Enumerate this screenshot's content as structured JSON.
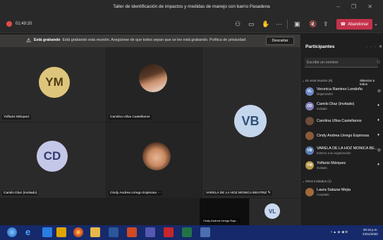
{
  "window": {
    "title": "Taller de identificación de impactos y medidas de manejo con barrio Pasadena"
  },
  "toolbar": {
    "timer": "01:49:20",
    "leave_label": "Abandonar",
    "icons": [
      "people-icon",
      "chat-icon",
      "raise-hand-icon",
      "more-icon",
      "camera-icon",
      "mic-icon",
      "share-icon"
    ]
  },
  "banner": {
    "bold": "Está grabando",
    "text": "Está grabando esta reunión. Asegúrese de que todos sepan que se les está grabando. Política de privacidad",
    "dismiss_label": "Descartar"
  },
  "tiles": [
    {
      "name": "Yolfanis Márquez",
      "initials": "YM",
      "color": "#ddc67c",
      "text_color": "#4f3a13"
    },
    {
      "name": "Carolina Ulloa Castellanos",
      "initials": "",
      "photo": true
    },
    {
      "name": "Camilo Díaz (Invitado)",
      "initials": "CD",
      "color": "#c4c8e8",
      "text_color": "#343a6a"
    },
    {
      "name": "Cindy Andrea Urrego Espinosa",
      "initials": "",
      "photo": true,
      "suffix": "···"
    },
    {
      "name": "VARELA DE LA HOZ MONICA BEATRIZ",
      "initials": "VB",
      "color": "#c4d6ec",
      "text_color": "#2f4f78"
    },
    {
      "name": "Cindy Andrea Urrego Espi...",
      "initials": "",
      "self_preview": true
    },
    {
      "name": "",
      "initials": "VL",
      "color": "#c9d9ee",
      "text_color": "#33507a"
    }
  ],
  "participants": {
    "title": "Participantes",
    "search_placeholder": "Escribir un nombre",
    "in_meeting_label": "En esta reunión (8)",
    "mute_all_label": "Silenciar a todos",
    "others_label": "Otros invitados (1)",
    "list": [
      {
        "name": "Veronica Ramirez Londoño",
        "role": "Organizador",
        "initials": "VL",
        "color": "#6e88c8"
      },
      {
        "name": "Camilo Díaz (Invitado)",
        "role": "Invitado",
        "initials": "CD",
        "color": "#7f7fb8"
      },
      {
        "name": "Carolina Ulloa Castellanos",
        "role": "",
        "initials": "",
        "color": "#6d4c3a"
      },
      {
        "name": "Cindy Andrea Urrego Espinosa",
        "role": "",
        "initials": "",
        "color": "#8b5a3a"
      },
      {
        "name": "VARELA DE LA HOZ MONICA BE...",
        "role": "Externo a su organización",
        "initials": "VB",
        "color": "#5b7fb3"
      },
      {
        "name": "Yolfanis Márquez",
        "role": "Invitado",
        "initials": "YM",
        "color": "#b89a4a"
      }
    ],
    "others": [
      {
        "name": "Laura Salazar Mejia",
        "role": "Aceptado",
        "initials": "",
        "color": "#a06a3a"
      }
    ]
  },
  "taskbar": {
    "time": "09:15 p.m.",
    "date": "24/11/2020"
  }
}
